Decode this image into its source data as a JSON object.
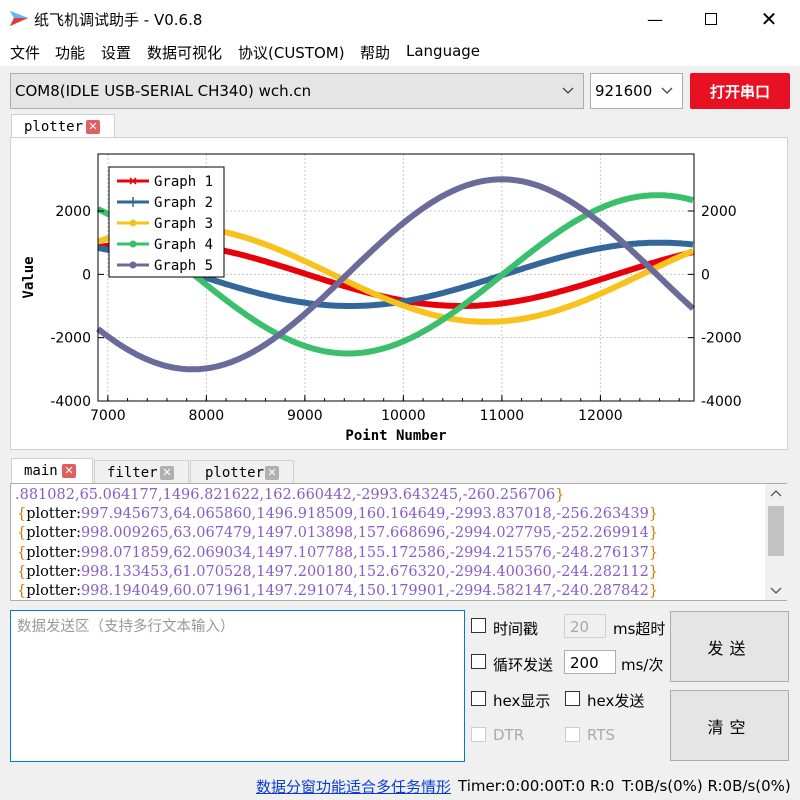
{
  "app": {
    "title": "纸飞机调试助手 - V0.6.8"
  },
  "menu": [
    "文件",
    "功能",
    "设置",
    "数据可视化",
    "协议(CUSTOM)",
    "帮助",
    "Language"
  ],
  "port": {
    "selected": "COM8(IDLE  USB-SERIAL CH340) wch.cn",
    "baud": "921600",
    "open_label": "打开串口"
  },
  "top_tabs": [
    {
      "label": "plotter",
      "active": true
    }
  ],
  "bottom_tabs": [
    {
      "label": "main",
      "active": true
    },
    {
      "label": "filter",
      "active": false
    },
    {
      "label": "plotter",
      "active": false
    }
  ],
  "chart_data": {
    "type": "line",
    "xlabel": "Point Number",
    "ylabel": "Value",
    "xlim": [
      6900,
      12950
    ],
    "ylim": [
      -4000,
      3800
    ],
    "xticks": [
      7000,
      8000,
      9000,
      10000,
      11000,
      12000
    ],
    "yticks": [
      -4000,
      -2000,
      0,
      2000
    ],
    "legend_position": "top-left",
    "grid": true,
    "series": [
      {
        "name": "Graph 1",
        "color": "#e8000b",
        "marker": "x",
        "amplitude": 1000,
        "period": 6283,
        "peak_at": 7450
      },
      {
        "name": "Graph 2",
        "color": "#336699",
        "marker": "+",
        "amplitude": 1000,
        "period": 6283,
        "peak_at": 12600
      },
      {
        "name": "Graph 3",
        "color": "#f8c21c",
        "marker": "dot",
        "amplitude": 1500,
        "period": 6283,
        "peak_at": 7710
      },
      {
        "name": "Graph 4",
        "color": "#3cbf6c",
        "marker": "dot",
        "amplitude": 2500,
        "period": 6283,
        "peak_at": 12580
      },
      {
        "name": "Graph 5",
        "color": "#6a6b9a",
        "marker": "dot",
        "amplitude": 3000,
        "period": 6283,
        "peak_at": 11000
      }
    ]
  },
  "log": {
    "first": ".881082,65.064177,1496.821622,162.660442,-2993.643245,-260.256706",
    "lines": [
      {
        "tag": "plotter",
        "values": "997.945673,64.065860,1496.918509,160.164649,-2993.837018,-256.263439"
      },
      {
        "tag": "plotter",
        "values": "998.009265,63.067479,1497.013898,157.668696,-2994.027795,-252.269914"
      },
      {
        "tag": "plotter",
        "values": "998.071859,62.069034,1497.107788,155.172586,-2994.215576,-248.276137"
      },
      {
        "tag": "plotter",
        "values": "998.133453,61.070528,1497.200180,152.676320,-2994.400360,-244.282112"
      },
      {
        "tag": "plotter",
        "values": "998.194049,60.071961,1497.291074,150.179901,-2994.582147,-240.287842"
      }
    ]
  },
  "send": {
    "placeholder": "数据发送区（支持多行文本输入）",
    "timestamp_label": "时间戳",
    "timeout_value": "20",
    "timeout_unit": "ms超时",
    "loop_label": "循环发送",
    "loop_value": "200",
    "loop_unit": "ms/次",
    "hex_display": "hex显示",
    "hex_send": "hex发送",
    "dtr": "DTR",
    "rts": "RTS",
    "send_btn": "发送",
    "clear_btn": "清空"
  },
  "status": {
    "link": "数据分窗功能适合多任务情形",
    "timer": "Timer:0:00:00",
    "tr": "T:0 R:0",
    "rate": "T:0B/s(0%) R:0B/s(0%)"
  }
}
